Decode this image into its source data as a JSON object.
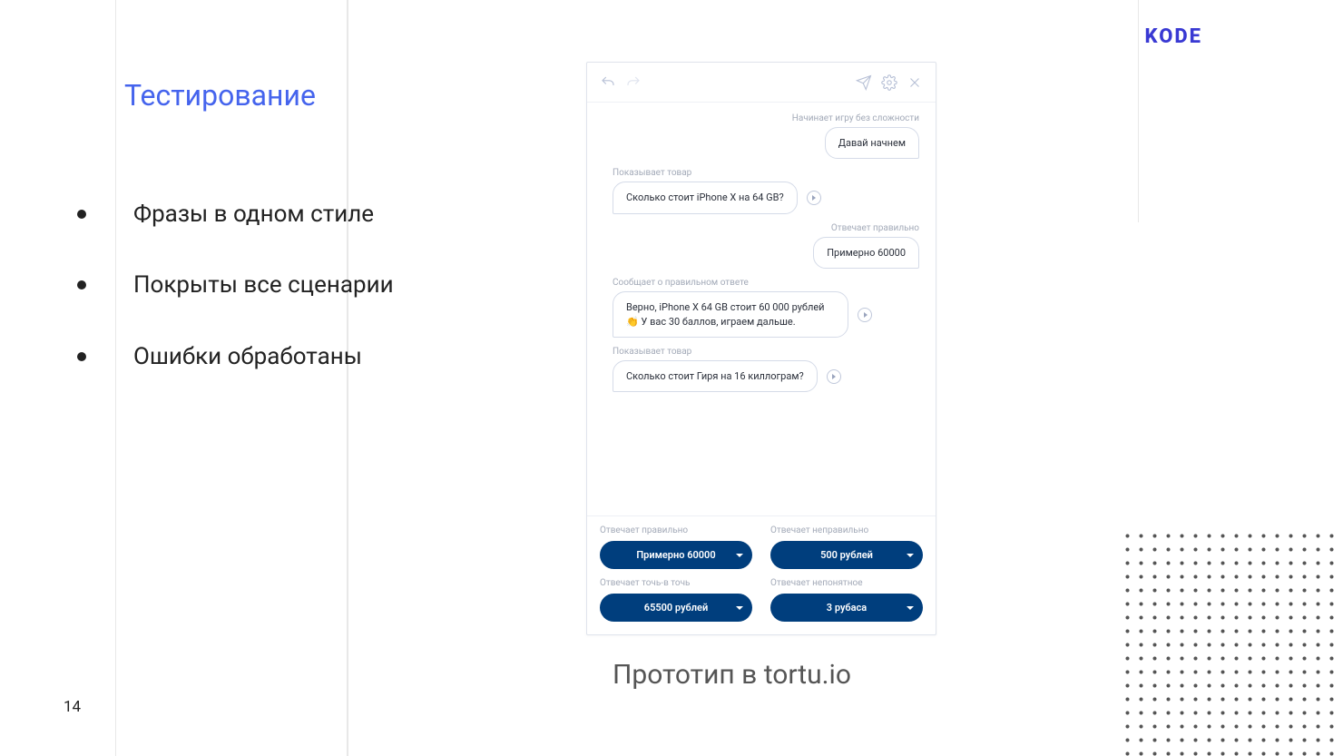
{
  "page_number": "14",
  "title": "Тестирование",
  "bullets": [
    "Фразы в одном стиле",
    "Покрыты все сценарии",
    "Ошибки обработаны"
  ],
  "logo": "KODE",
  "caption": "Прототип в tortu.io",
  "proto": {
    "seg1_label": "Начинает игру без сложности",
    "seg1_bubble": "Давай начнем",
    "seg2_label": "Показывает товар",
    "seg2_bubble": "Сколько стоит iPhone X на 64 GB?",
    "seg3_label": "Отвечает правильно",
    "seg3_bubble": "Примерно 60000",
    "seg4_label": "Сообщает о правильном ответе",
    "seg4_bubble": "Верно, iPhone X 64 GB стоит 60 000 рублей 👏 У вас 30 баллов, играем дальше.",
    "seg5_label": "Показывает товар",
    "seg5_bubble": "Сколько стоит Гиря на 16 киллограм?",
    "foot": [
      {
        "label": "Отвечает правильно",
        "pill": "Примерно 60000"
      },
      {
        "label": "Отвечает неправильно",
        "pill": "500 рублей"
      },
      {
        "label": "Отвечает точь-в точь",
        "pill": "65500 рублей"
      },
      {
        "label": "Отвечает непонятное",
        "pill": "3 рубаса"
      }
    ]
  }
}
